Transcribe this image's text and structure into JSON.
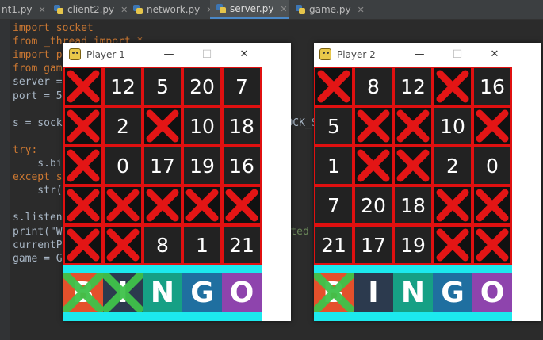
{
  "tabs": [
    {
      "label": "nt1.py",
      "active": false
    },
    {
      "label": "client2.py",
      "active": false
    },
    {
      "label": "network.py",
      "active": false
    },
    {
      "label": "server.py",
      "active": true
    },
    {
      "label": "game.py",
      "active": false
    }
  ],
  "code_lines": [
    [
      "import socket"
    ],
    [
      "from _thread import *"
    ],
    [
      "import p"
    ],
    [
      "from gam"
    ],
    [
      "server ="
    ],
    [
      "port = 5"
    ],
    [
      ""
    ],
    [
      "s = sock",
      "t.SOCK_ST"
    ],
    [
      ""
    ],
    [
      "try:"
    ],
    [
      "    s.bi"
    ],
    [
      "except s"
    ],
    [
      "    str("
    ],
    [
      ""
    ],
    [
      "s.listen"
    ],
    [
      "print(\"W",
      "Started"
    ],
    [
      "currentP"
    ],
    [
      "game = G"
    ]
  ],
  "windows": [
    {
      "title": "Player 1",
      "cells": [
        [
          "X",
          "12",
          "5",
          "20",
          "7"
        ],
        [
          "X",
          "2",
          "X",
          "10",
          "18"
        ],
        [
          "X",
          "0",
          "17",
          "19",
          "16"
        ],
        [
          "X",
          "X",
          "X",
          "X",
          "X"
        ],
        [
          "X",
          "X",
          "8",
          "1",
          "21"
        ]
      ],
      "bingo_letters": [
        "B",
        "I",
        "N",
        "G",
        "O"
      ],
      "bingo_struck": [
        true,
        true,
        false,
        false,
        false
      ]
    },
    {
      "title": "Player 2",
      "cells": [
        [
          "X",
          "8",
          "12",
          "X",
          "16"
        ],
        [
          "5",
          "X",
          "X",
          "10",
          "X"
        ],
        [
          "1",
          "X",
          "X",
          "2",
          "0"
        ],
        [
          "7",
          "20",
          "18",
          "X",
          "X"
        ],
        [
          "21",
          "17",
          "19",
          "X",
          "X"
        ]
      ],
      "bingo_letters": [
        "B",
        "I",
        "N",
        "G",
        "O"
      ],
      "bingo_struck": [
        true,
        false,
        false,
        false,
        false
      ]
    }
  ],
  "window_buttons": {
    "minimize": "—",
    "maximize": "☐",
    "close": "✕"
  },
  "colors": {
    "cell_border": "#e01010",
    "x_mark": "#e31515",
    "cyan": "#1ce9ee",
    "bingo_tiles": [
      "#e4502b",
      "#2c3a4e",
      "#16a085",
      "#1f6fa0",
      "#8e44ad"
    ],
    "bingo_strike": "#3fc24a"
  }
}
